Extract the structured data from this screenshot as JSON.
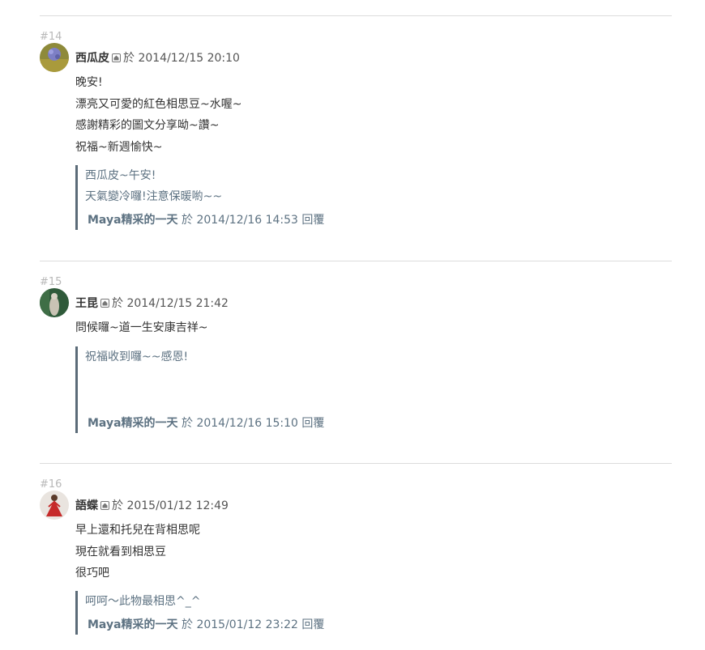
{
  "comments": [
    {
      "num": "#14",
      "author": "西瓜皮",
      "at": "於",
      "time": "2014/12/15 20:10",
      "lines": [
        "晚安!",
        "漂亮又可愛的紅色相思豆~水喔~",
        "感謝精彩的圖文分享呦~讚~",
        "祝福~新週愉快~"
      ],
      "reply": {
        "lines": [
          "西瓜皮~午安!",
          "天氣變冷囉!注意保暖喲~~"
        ],
        "author": "Maya精采的一天",
        "at": "於",
        "time": "2014/12/16 14:53",
        "action": "回覆"
      }
    },
    {
      "num": "#15",
      "author": "王昆",
      "at": "於",
      "time": "2014/12/15 21:42",
      "lines": [
        "問候囉~道一生安康吉祥~"
      ],
      "reply": {
        "lines": [
          "祝福收到囉~~感恩!"
        ],
        "author": "Maya精采的一天",
        "at": "於",
        "time": "2014/12/16 15:10",
        "action": "回覆"
      }
    },
    {
      "num": "#16",
      "author": "語蝶",
      "at": "於",
      "time": "2015/01/12 12:49",
      "lines": [
        "早上還和托兒在背相思呢",
        "現在就看到相思豆",
        "很巧吧"
      ],
      "reply": {
        "lines": [
          "呵呵～此物最相思^_^"
        ],
        "author": "Maya精采的一天",
        "at": "於",
        "time": "2015/01/12 23:22",
        "action": "回覆"
      }
    }
  ]
}
